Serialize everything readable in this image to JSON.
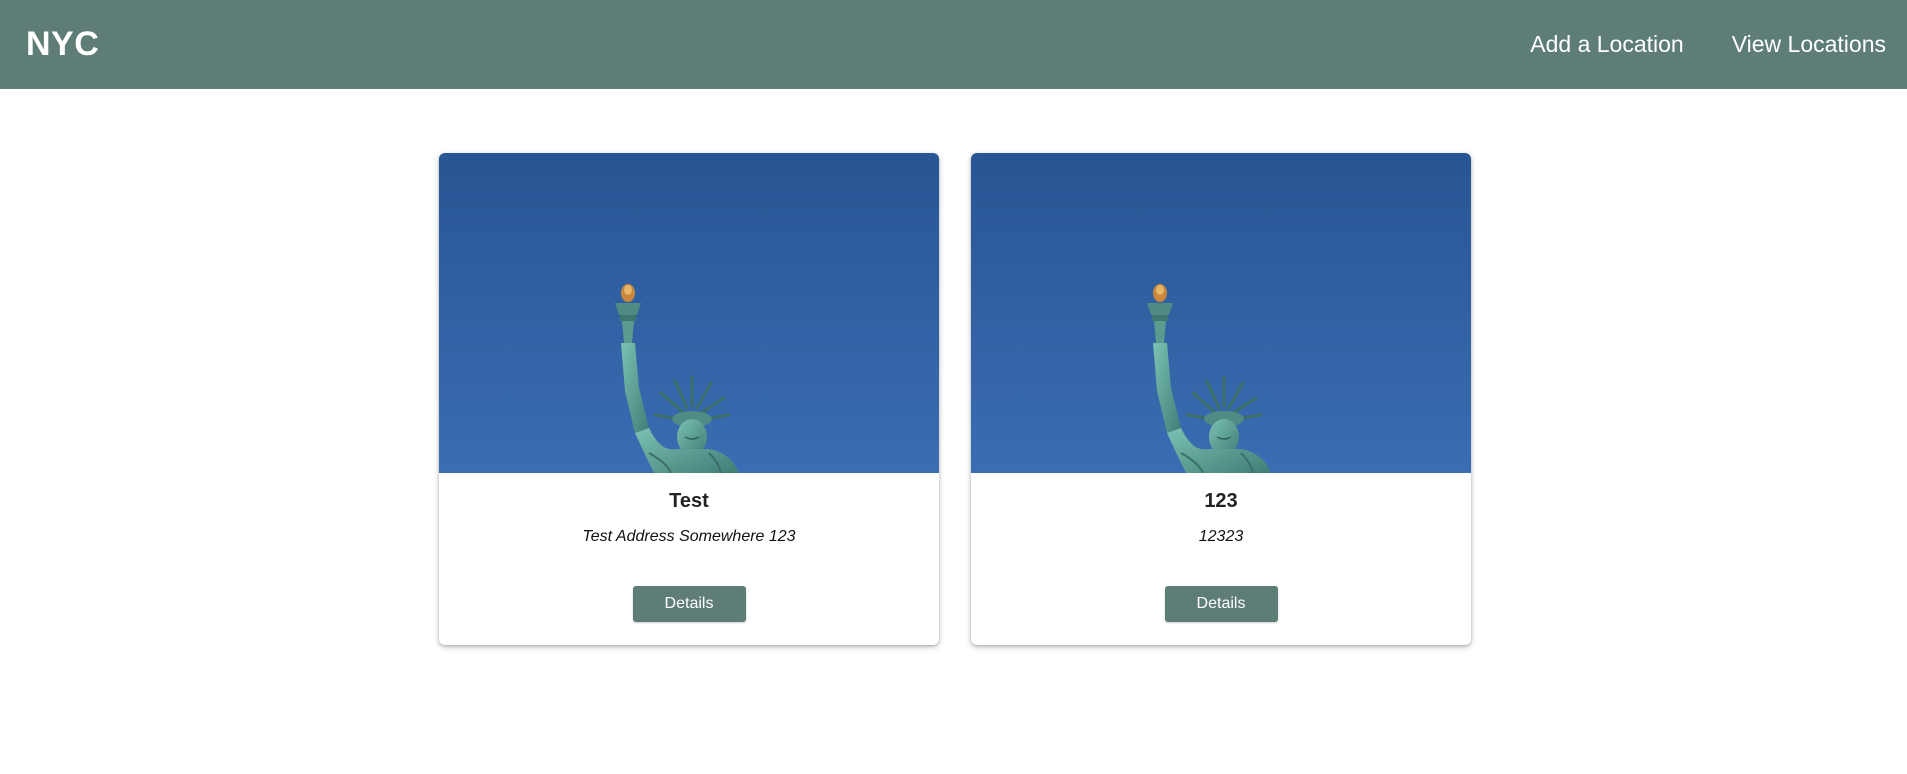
{
  "navbar": {
    "brand": "NYC",
    "links": [
      {
        "label": "Add a Location"
      },
      {
        "label": "View Locations"
      }
    ],
    "background": "#5e7d77"
  },
  "cards": [
    {
      "image": "statue-of-liberty-photo",
      "title": "Test",
      "address": "Test Address Somewhere 123",
      "button_label": "Details"
    },
    {
      "image": "statue-of-liberty-photo",
      "title": "123",
      "address": "12323",
      "button_label": "Details"
    }
  ],
  "colors": {
    "accent": "#5e7d77",
    "sky": "#2f5f9f",
    "statue": "#5fa39a"
  }
}
